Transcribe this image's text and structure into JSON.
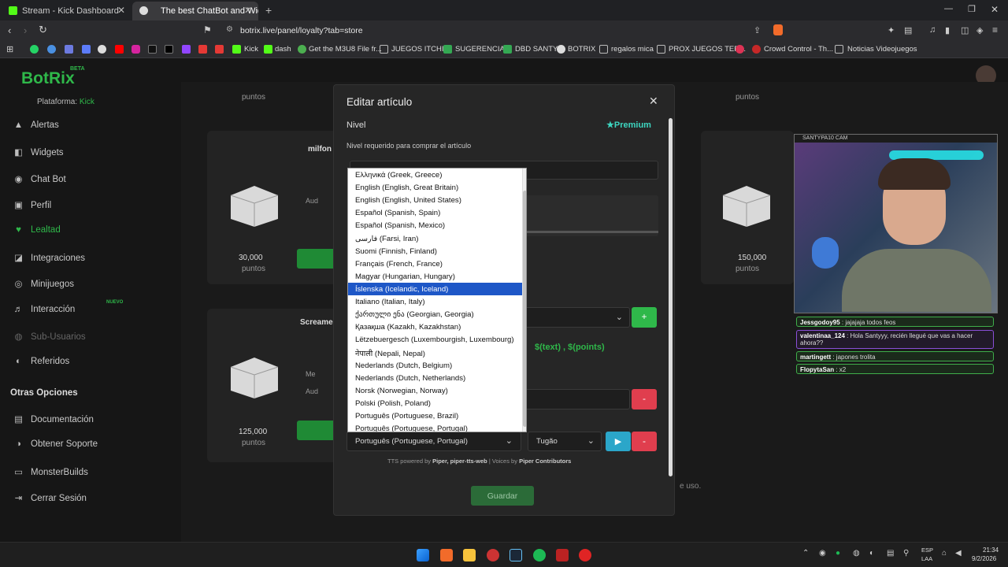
{
  "browser": {
    "tabs": [
      {
        "title": "Stream - Kick Dashboard",
        "active": false
      },
      {
        "title": "The best ChatBot and Widge",
        "active": true
      }
    ],
    "url": "botrix.live/panel/loyalty?tab=store",
    "bookmarks": [
      "Kick",
      "dash",
      "Get the M3U8 File fr...",
      "JUEGOS ITCHIO",
      "SUGERENCIAS",
      "DBD SANTY",
      "BOTRIX",
      "regalos mica",
      "PROX JUEGOS TER...",
      "Crowd Control - Th...",
      "Noticias Videojuegos"
    ]
  },
  "app": {
    "logo": "BotRix",
    "logo_badge": "BETA",
    "platform_label": "Plataforma:",
    "platform_value": "Kick"
  },
  "sidebar": {
    "items": [
      {
        "label": "Alertas",
        "icon": "bell-icon"
      },
      {
        "label": "Widgets",
        "icon": "widgets-icon"
      },
      {
        "label": "Chat Bot",
        "icon": "chat-icon"
      },
      {
        "label": "Perfil",
        "icon": "profile-icon"
      },
      {
        "label": "Lealtad",
        "icon": "loyalty-icon"
      },
      {
        "label": "Integraciones",
        "icon": "integrations-icon"
      },
      {
        "label": "Minijuegos",
        "icon": "minigames-icon"
      },
      {
        "label": "Interacción",
        "icon": "music-icon",
        "badge": "NUEVO"
      },
      {
        "label": "Sub-Usuarios",
        "icon": "users-icon"
      },
      {
        "label": "Referidos",
        "icon": "referrals-icon"
      }
    ],
    "other_heading": "Otras Opciones",
    "other_items": [
      {
        "label": "Documentación",
        "icon": "docs-icon"
      },
      {
        "label": "Obtener Soporte",
        "icon": "support-icon"
      },
      {
        "label": "MonsterBuilds",
        "icon": "monster-icon"
      },
      {
        "label": "Cerrar Sesión",
        "icon": "logout-icon"
      }
    ]
  },
  "background_cards": {
    "points_label": "puntos",
    "card1_title": "milfon",
    "card1_price": "30,000",
    "card2_title": "Screame",
    "card2_price": "125,000",
    "card3_price": "150,000",
    "aud_label": "Aud",
    "mer_label": "Me",
    "footer_fragment": "e uso."
  },
  "modal": {
    "title": "Editar artículo",
    "section_label": "Nivel",
    "premium_label": "Premium",
    "level_help": "Nivel requerido para comprar el artículo",
    "vars_hint": "$(text) , $(points)",
    "selected_language": "Português (Portuguese, Portugal)",
    "voice": "Tugão",
    "tts_credit_prefix": "TTS powered by",
    "tts_credit_piper": "Piper, piper-tts-web",
    "tts_credit_voices": "Voices by",
    "tts_credit_contrib": "Piper Contributors",
    "save_label": "Guardar",
    "add_label": "+",
    "remove_label": "-",
    "play_label": "▶"
  },
  "language_options": [
    "Ελληνικά (Greek, Greece)",
    "English (English, Great Britain)",
    "English (English, United States)",
    "Español (Spanish, Spain)",
    "Español (Spanish, Mexico)",
    "فارسی (Farsi, Iran)",
    "Suomi (Finnish, Finland)",
    "Français (French, France)",
    "Magyar (Hungarian, Hungary)",
    "Íslenska (Icelandic, Iceland)",
    "Italiano (Italian, Italy)",
    "ქართული ენა (Georgian, Georgia)",
    "Қазақша (Kazakh, Kazakhstan)",
    "Lëtzebuergesch (Luxembourgish, Luxembourg)",
    "नेपाली (Nepali, Nepal)",
    "Nederlands (Dutch, Belgium)",
    "Nederlands (Dutch, Netherlands)",
    "Norsk (Norwegian, Norway)",
    "Polski (Polish, Poland)",
    "Português (Portuguese, Brazil)",
    "Português (Portuguese, Portugal)"
  ],
  "highlighted_option_index": 9,
  "overlay": {
    "cam_label": "SANTYPA10 CAM",
    "chat": [
      {
        "user": "Jessgodoy95",
        "text": "jajajaja todos feos"
      },
      {
        "user": "valentinaa_124",
        "text": "Hola Santyyy, recién llegué que vas a hacer ahora??"
      },
      {
        "user": "martingett",
        "text": "japones trolita"
      },
      {
        "user": "FlopytaSan",
        "text": "x2"
      }
    ]
  },
  "taskbar": {
    "lang": "ESP",
    "region": "LAA",
    "time": "21:34",
    "date": "9/2/2026"
  },
  "colors": {
    "accent": "#2fb84a",
    "danger": "#e03e4e",
    "selected": "#1e57c7",
    "premium": "#3dd6c0"
  }
}
